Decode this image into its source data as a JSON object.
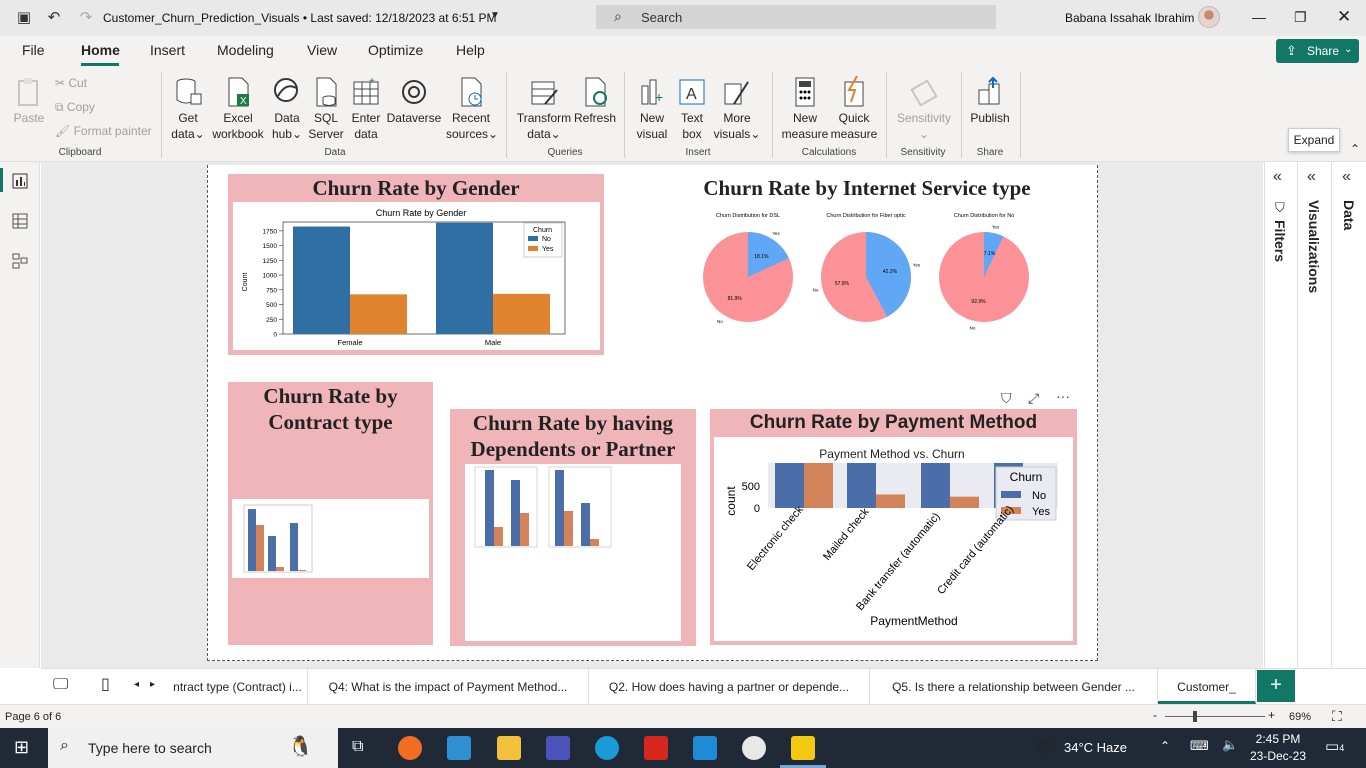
{
  "window": {
    "title": "Customer_Churn_Prediction_Visuals • Last saved: 12/18/2023 at 6:51 PM",
    "search_placeholder": "Search",
    "user_name": "Babana Issahak Ibrahim"
  },
  "menu": {
    "items": [
      "File",
      "Home",
      "Insert",
      "Modeling",
      "View",
      "Optimize",
      "Help"
    ],
    "active": "Home",
    "share_label": "Share"
  },
  "ribbon": {
    "clipboard": {
      "paste": "Paste",
      "cut": "Cut",
      "copy": "Copy",
      "format_painter": "Format painter",
      "label": "Clipboard"
    },
    "data": {
      "get_data": [
        "Get",
        "data"
      ],
      "excel": [
        "Excel",
        "workbook"
      ],
      "data_hub": [
        "Data",
        "hub"
      ],
      "sql": [
        "SQL",
        "Server"
      ],
      "enter_data": [
        "Enter",
        "data"
      ],
      "dataverse": "Dataverse",
      "recent": [
        "Recent",
        "sources"
      ],
      "label": "Data"
    },
    "queries": {
      "transform": [
        "Transform",
        "data"
      ],
      "refresh": "Refresh",
      "label": "Queries"
    },
    "insert": {
      "new_visual": [
        "New",
        "visual"
      ],
      "text_box": [
        "Text",
        "box"
      ],
      "more_visuals": [
        "More",
        "visuals"
      ],
      "label": "Insert"
    },
    "calculations": {
      "new_measure": [
        "New",
        "measure"
      ],
      "quick_measure": [
        "Quick",
        "measure"
      ],
      "label": "Calculations"
    },
    "sensitivity": {
      "btn": "Sensitivity",
      "label": "Sensitivity"
    },
    "share": {
      "publish": "Publish",
      "label": "Share"
    }
  },
  "panes": {
    "filters": "Filters",
    "visualizations": "Visualizations",
    "data": "Data",
    "expand_tooltip": "Expand"
  },
  "visuals": {
    "gender": {
      "title": "Churn Rate by Gender",
      "chart_title": "Churn Rate by Gender",
      "ylabel": "Count",
      "legend_title": "Churn",
      "legend": [
        "No",
        "Yes"
      ],
      "categories": [
        "Female",
        "Male"
      ],
      "yticks": [
        "1750",
        "1500",
        "1250",
        "1000",
        "750",
        "500",
        "250",
        "0"
      ]
    },
    "internet": {
      "title": "Churn Rate by Internet Service type",
      "pies": [
        {
          "title": "Churn Distribution for DSL",
          "yes_pct": "18.1%",
          "no_pct": "81.9%",
          "yes": "Yes",
          "no": "No"
        },
        {
          "title": "Churn Distribution for Fiber optic",
          "yes_pct": "42.2%",
          "no_pct": "57.8%",
          "yes": "Yes",
          "no": "No"
        },
        {
          "title": "Churn Distribution for No",
          "yes_pct": "7.1%",
          "no_pct": "92.9%",
          "yes": "Yes",
          "no": "No"
        }
      ]
    },
    "contract": {
      "title_line1": "Churn Rate by",
      "title_line2": "Contract type"
    },
    "dependents": {
      "title_line1": "Churn Rate by having",
      "title_line2": "Dependents or Partner"
    },
    "payment": {
      "title": "Churn Rate by Payment Method",
      "chart_title": "Payment Method vs. Churn",
      "ylabel": "count",
      "xlabel": "PaymentMethod",
      "legend_title": "Churn",
      "legend": [
        "No",
        "Yes"
      ],
      "categories": [
        "Electronic check",
        "Mailed check",
        "Bank transfer (automatic)",
        "Credit card (automatic)"
      ],
      "yticks": [
        "500",
        "0"
      ]
    }
  },
  "tabs": [
    "ntract type (Contract) i...",
    "Q4: What is the impact of Payment Method...",
    "Q2. How does having a partner or depende...",
    "Q5. Is there a relationship between Gender ...",
    "Customer_"
  ],
  "status": {
    "page": "Page 6 of 6",
    "zoom": "69%"
  },
  "taskbar": {
    "search": "Type here to search",
    "weather": "34°C  Haze",
    "time": "2:45 PM",
    "date": "23-Dec-23",
    "notif": "4"
  },
  "colors": {
    "accent": "#117865",
    "visual_bg": "#efb5b8",
    "bar_no": "#2f6fa3",
    "bar_yes": "#e0832e",
    "pie_yes": "#60a8f5",
    "pie_no": "#fb9298",
    "pay_no": "#4c6ea8",
    "pay_yes": "#d3835a"
  },
  "chart_data": [
    {
      "type": "bar",
      "title": "Churn Rate by Gender",
      "categories": [
        "Female",
        "Male"
      ],
      "series": [
        {
          "name": "No",
          "values": [
            1823,
            1887
          ]
        },
        {
          "name": "Yes",
          "values": [
            673,
            681
          ]
        }
      ],
      "ylabel": "Count",
      "ylim": [
        0,
        1900
      ]
    },
    {
      "type": "pie",
      "title": "Churn Distribution for DSL",
      "labels": [
        "Yes",
        "No"
      ],
      "values": [
        18.1,
        81.9
      ]
    },
    {
      "type": "pie",
      "title": "Churn Distribution for Fiber optic",
      "labels": [
        "Yes",
        "No"
      ],
      "values": [
        42.2,
        57.8
      ]
    },
    {
      "type": "pie",
      "title": "Churn Distribution for No",
      "labels": [
        "Yes",
        "No"
      ],
      "values": [
        7.1,
        92.9
      ]
    },
    {
      "type": "bar",
      "title": "Payment Method vs. Churn",
      "categories": [
        "Electronic check",
        "Mailed check",
        "Bank transfer (automatic)",
        "Credit card (automatic)"
      ],
      "series": [
        {
          "name": "No",
          "values": [
            1294,
            1304,
            1286,
            1290
          ]
        },
        {
          "name": "Yes",
          "values": [
            1071,
            308,
            258,
            232
          ]
        }
      ],
      "xlabel": "PaymentMethod",
      "ylabel": "count",
      "ylim": [
        0,
        1300
      ]
    }
  ]
}
